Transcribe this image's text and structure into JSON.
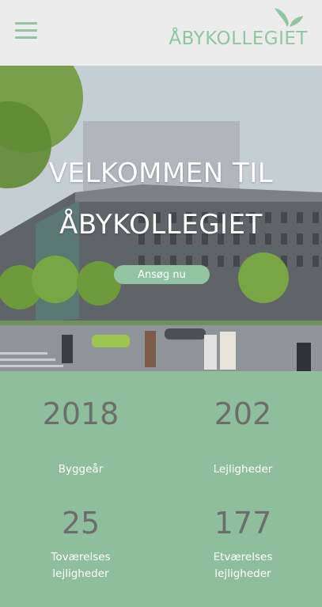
{
  "header": {
    "logo_text": "ÅBYKOLLEGIET",
    "menu_icon": "hamburger-menu-icon",
    "logo_icon": "leaf-icon"
  },
  "hero": {
    "title_line1": "VELKOMMEN TIL",
    "title_line2": "ÅBYKOLLEGIET",
    "button_label": "Ansøg nu"
  },
  "stats": [
    {
      "value": "2018",
      "label": "Byggeår"
    },
    {
      "value": "202",
      "label": "Lejligheder"
    },
    {
      "value": "25",
      "label": "Toværelses lejligheder"
    },
    {
      "value": "177",
      "label": "Etværelses lejligheder"
    }
  ],
  "colors": {
    "accent": "#93c4a2",
    "stats_bg": "#8fbe9c",
    "number_text": "#6b6f6c",
    "header_bg": "#ececec"
  }
}
